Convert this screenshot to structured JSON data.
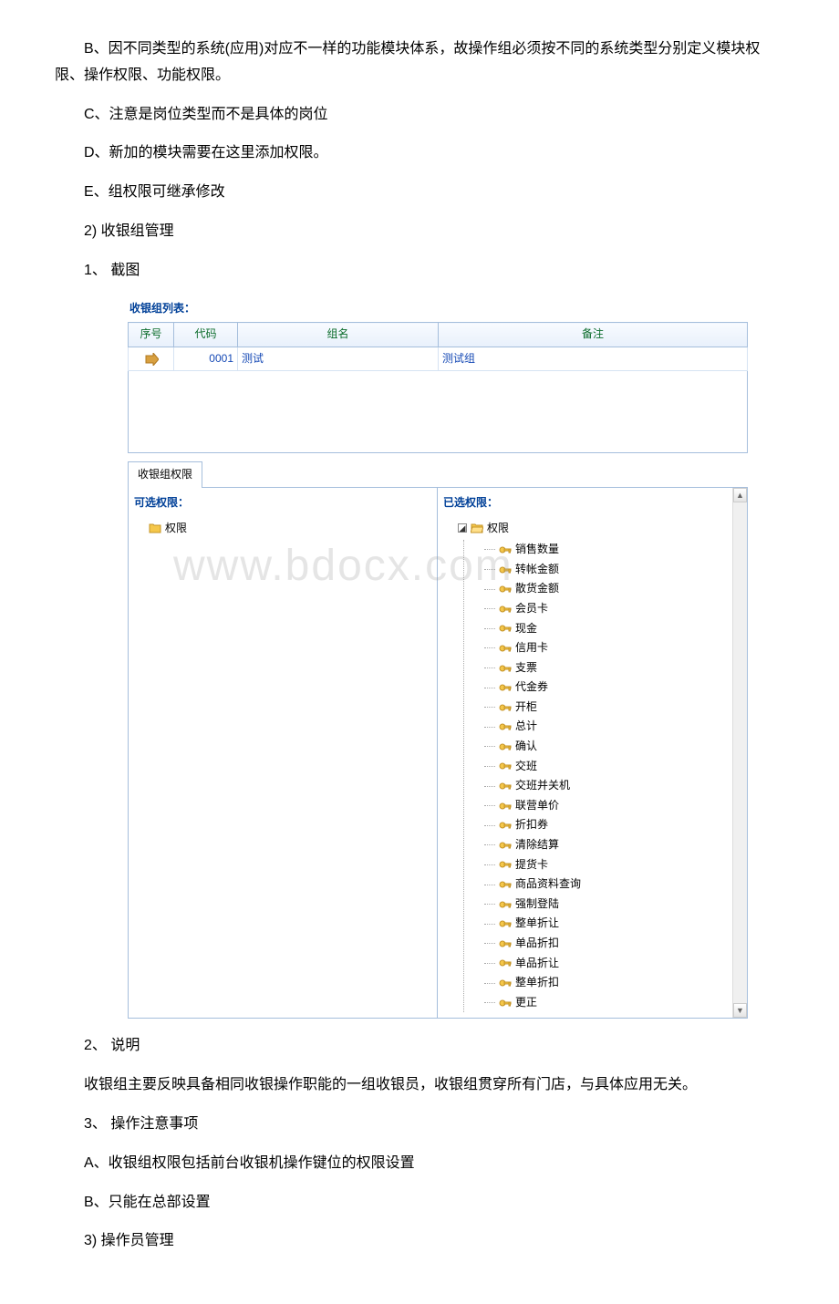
{
  "paragraphs": {
    "p_b": "B、因不同类型的系统(应用)对应不一样的功能模块体系，故操作组必须按不同的系统类型分别定义模块权限、操作权限、功能权限。",
    "p_c": "C、注意是岗位类型而不是具体的岗位",
    "p_d": "D、新加的模块需要在这里添加权限。",
    "p_e": "E、组权限可继承修改",
    "p_2": "2) 收银组管理",
    "p_1cap": "1、 截图",
    "p_2desc_title": "2、 说明",
    "p_2desc": "收银组主要反映具备相同收银操作职能的一组收银员，收银组贯穿所有门店，与具体应用无关。",
    "p_3title": "3、 操作注意事项",
    "p_3a": "A、收银组权限包括前台收银机操作键位的权限设置",
    "p_3b": "B、只能在总部设置",
    "p_3next": "3) 操作员管理"
  },
  "ui": {
    "list_title": "收银组列表：",
    "columns": {
      "seq": "序号",
      "code": "代码",
      "name": "组名",
      "remark": "备注"
    },
    "row": {
      "code": "0001",
      "name": "测试",
      "remark": "测试组"
    },
    "tab": "收银组权限",
    "left_label": "可选权限：",
    "right_label": "已选权限：",
    "root_label": "权限",
    "perm_items": [
      "销售数量",
      "转帐金额",
      "散货金额",
      "会员卡",
      "现金",
      "信用卡",
      "支票",
      "代金券",
      "开柜",
      "总计",
      "确认",
      "交班",
      "交班并关机",
      "联营单价",
      "折扣券",
      "清除结算",
      "提货卡",
      "商品资料查询",
      "强制登陆",
      "整单折让",
      "单品折扣",
      "单品折让",
      "整单折扣",
      "更正"
    ]
  },
  "watermark": "www.bdocx.com"
}
